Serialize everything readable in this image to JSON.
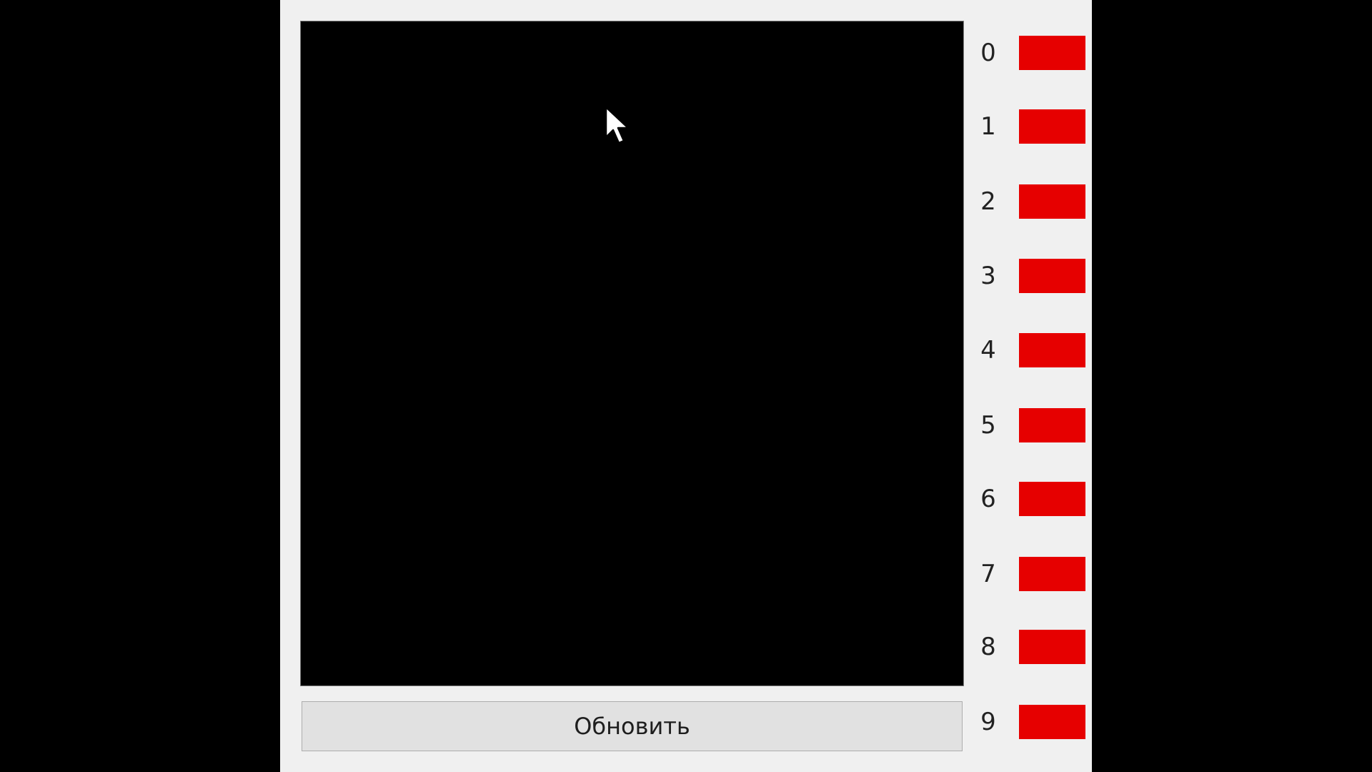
{
  "main": {
    "canvas_color": "#000000",
    "update_button_label": "Обновить"
  },
  "digits": [
    {
      "label": "0",
      "color": "#e60000"
    },
    {
      "label": "1",
      "color": "#e60000"
    },
    {
      "label": "2",
      "color": "#e60000"
    },
    {
      "label": "3",
      "color": "#e60000"
    },
    {
      "label": "4",
      "color": "#e60000"
    },
    {
      "label": "5",
      "color": "#e60000"
    },
    {
      "label": "6",
      "color": "#e60000"
    },
    {
      "label": "7",
      "color": "#e60000"
    },
    {
      "label": "8",
      "color": "#e60000"
    },
    {
      "label": "9",
      "color": "#e60000"
    }
  ],
  "pointer": {
    "icon": "arrow-cursor-icon"
  }
}
